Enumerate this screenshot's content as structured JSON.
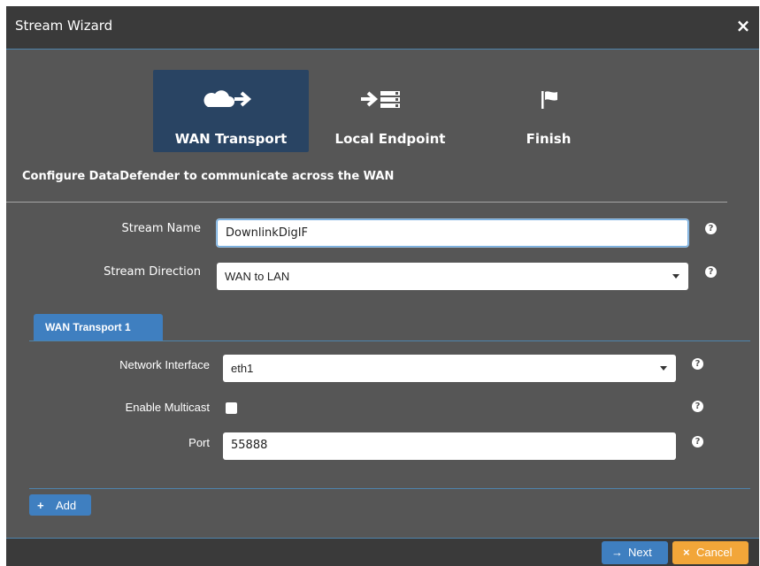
{
  "window": {
    "title": "Stream Wizard"
  },
  "steps": [
    {
      "label": "WAN Transport",
      "active": true,
      "icons": [
        "cloud-icon",
        "arrow-right-icon"
      ]
    },
    {
      "label": "Local Endpoint",
      "active": false,
      "icons": [
        "arrow-right-icon",
        "server-icon"
      ]
    },
    {
      "label": "Finish",
      "active": false,
      "icons": [
        "flag-icon"
      ]
    }
  ],
  "subtitle": "Configure DataDefender to communicate across the WAN",
  "form": {
    "stream_name": {
      "label": "Stream Name",
      "value": "DownlinkDigIF"
    },
    "stream_direction": {
      "label": "Stream Direction",
      "value": "WAN to LAN"
    }
  },
  "transport_tab": {
    "label": "WAN Transport 1"
  },
  "transport": {
    "network_interface": {
      "label": "Network Interface",
      "value": "eth1"
    },
    "enable_multicast": {
      "label": "Enable Multicast",
      "checked": false
    },
    "port": {
      "label": "Port",
      "value": "55888"
    }
  },
  "help_glyph": "?",
  "buttons": {
    "add": {
      "glyph": "+",
      "label": "Add"
    },
    "next": {
      "glyph": "→",
      "label": "Next"
    },
    "cancel": {
      "glyph": "×",
      "label": "Cancel"
    }
  },
  "close_glyph": "×",
  "colors": {
    "accent": "#3f7fc0",
    "active_step": "#294463",
    "cancel": "#f2a639",
    "panel": "#565656",
    "header": "#3a3a3a"
  }
}
